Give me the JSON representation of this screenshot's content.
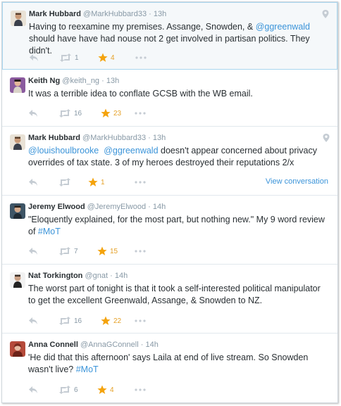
{
  "colors": {
    "link": "#3b94d9",
    "favorite": "#f4a30d",
    "meta": "#8899a6",
    "highlight_bg": "#f5f8fa",
    "highlight_border": "#a9d6ef"
  },
  "tweets": [
    {
      "name": "Mark Hubbard",
      "handle": "@MarkHubbard33",
      "sep": "·",
      "time": "13h",
      "text_a": "Having to reexamine my premises. Assange, Snowden, & ",
      "mention_a": "@ggreenwald",
      "text_b": " should have have had nouse not 2 get involved in partisan politics. They didn't.",
      "retweets": "1",
      "favorites": "4",
      "icons": [
        "reply-icon",
        "retweet-icon",
        "star-icon",
        "more-icon",
        "location-pin-icon"
      ]
    },
    {
      "name": "Keith Ng",
      "handle": "@keith_ng",
      "sep": "·",
      "time": "13h",
      "text_a": "It was a terrible idea to conflate GCSB with the WB email.",
      "retweets": "16",
      "favorites": "23"
    },
    {
      "name": "Mark Hubbard",
      "handle": "@MarkHubbard33",
      "sep": "·",
      "time": "13h",
      "mention_a": "@louishoulbrooke",
      "mention_b": "@ggreenwald",
      "text_b": " doesn't appear concerned about privacy overrides of tax state. 3 of my heroes destroyed their reputations 2/x",
      "retweets": "",
      "favorites": "1",
      "view_conversation": "View conversation"
    },
    {
      "name": "Jeremy Elwood",
      "handle": "@JeremyElwood",
      "sep": "·",
      "time": "14h",
      "text_a": "\"Eloquently explained, for the most part, but nothing new.\" My 9 word review of ",
      "hashtag": "#MoT",
      "retweets": "7",
      "favorites": "15"
    },
    {
      "name": "Nat Torkington",
      "handle": "@gnat",
      "sep": "·",
      "time": "14h",
      "text_a": "The worst part of tonight is that it took a self-interested political manipulator to get the excellent Greenwald, Assange, & Snowden to NZ.",
      "retweets": "16",
      "favorites": "22"
    },
    {
      "name": "Anna Connell",
      "handle": "@AnnaGConnell",
      "sep": "·",
      "time": "14h",
      "text_a": "'He did that this afternoon' says Laila at end of live stream. So Snowden wasn't live? ",
      "hashtag": "#MoT",
      "retweets": "6",
      "favorites": "4"
    }
  ]
}
